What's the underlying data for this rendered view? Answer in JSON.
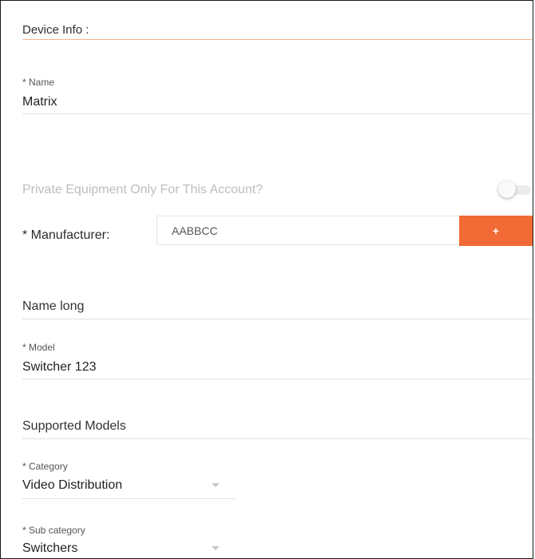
{
  "device_info": {
    "title": "Device Info :"
  },
  "name": {
    "label": "* Name",
    "value": "Matrix"
  },
  "private_toggle": {
    "label": "Private Equipment Only For This Account?",
    "enabled": false
  },
  "manufacturer": {
    "label": "* Manufacturer:",
    "value": "AABBCC",
    "add_label": "+"
  },
  "name_long": {
    "placeholder": "Name long"
  },
  "model": {
    "label": "* Model",
    "value": "Switcher 123"
  },
  "supported_models": {
    "placeholder": "Supported Models"
  },
  "category": {
    "label": "* Category",
    "value": "Video Distribution"
  },
  "sub_category": {
    "label": "* Sub category",
    "value": "Switchers"
  },
  "colors": {
    "accent": "#f26a35",
    "section_rule": "#f0b48c"
  },
  "icons": {
    "dropdown": "chevron-down-icon"
  }
}
